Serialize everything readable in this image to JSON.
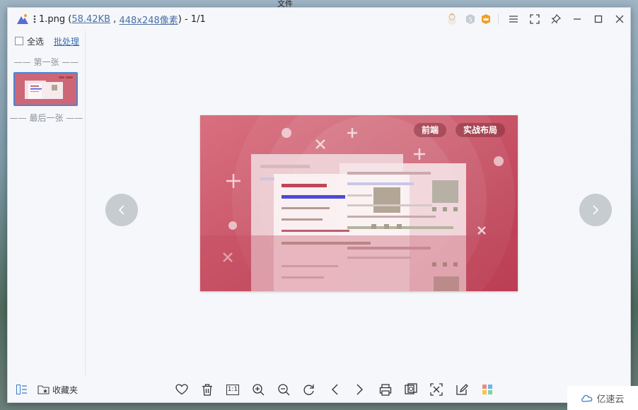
{
  "desktop": {
    "top_label": "文件"
  },
  "titlebar": {
    "filename": "1.png",
    "open_paren": " (",
    "file_size": "58.42KB",
    "sep": " , ",
    "dimensions": "448x248像素",
    "close_paren": ")",
    "counter": " - 1/1"
  },
  "sidebar": {
    "select_all": "全选",
    "batch": "批处理",
    "first_label": "—— 第一张 ——",
    "last_label": "—— 最后一张 ——"
  },
  "image": {
    "tags": [
      "前端",
      "实战布局"
    ]
  },
  "bottombar": {
    "favorites": "收藏夹",
    "actual_size": "1:1"
  },
  "watermark": {
    "text": "亿速云"
  },
  "colors": {
    "accent": "#4b86d6",
    "image_bg": "#c95e6e",
    "nav_btn": "#c7ccd1"
  }
}
